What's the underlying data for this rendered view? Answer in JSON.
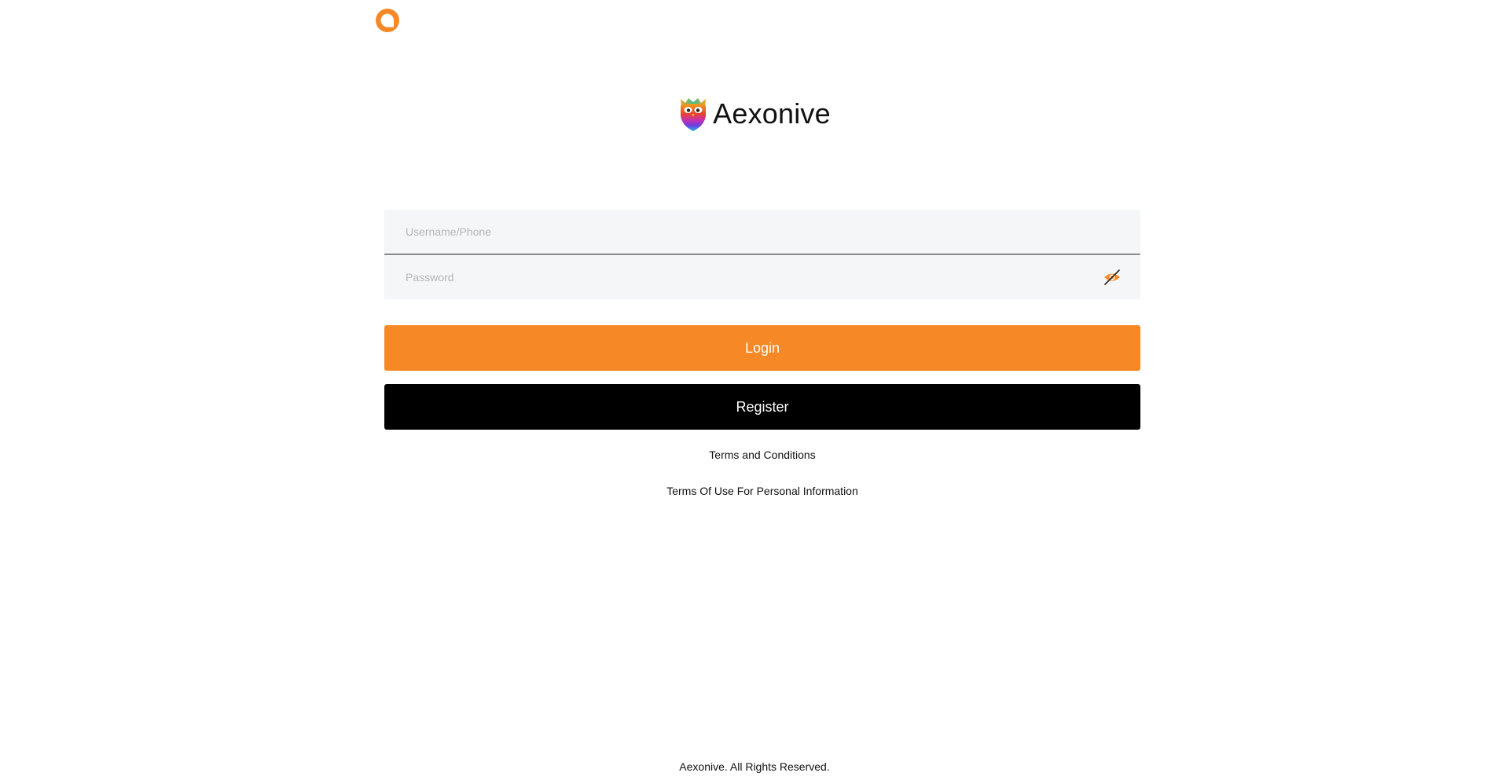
{
  "app": {
    "brand_name": "Aexonive"
  },
  "header": {
    "support_icon": "chat-bubble-icon"
  },
  "login_form": {
    "username_placeholder": "Username/Phone",
    "username_value": "",
    "password_placeholder": "Password",
    "password_value": "",
    "password_toggle_icon": "eye-hidden-icon",
    "login_label": "Login",
    "register_label": "Register"
  },
  "links": {
    "terms": "Terms and Conditions",
    "privacy": "Terms Of Use For Personal Information"
  },
  "footer": {
    "copyright": "Aexonive. All Rights Reserved."
  },
  "colors": {
    "accent": "#f68826",
    "register_bg": "#000000",
    "field_bg": "#f5f6f7"
  }
}
